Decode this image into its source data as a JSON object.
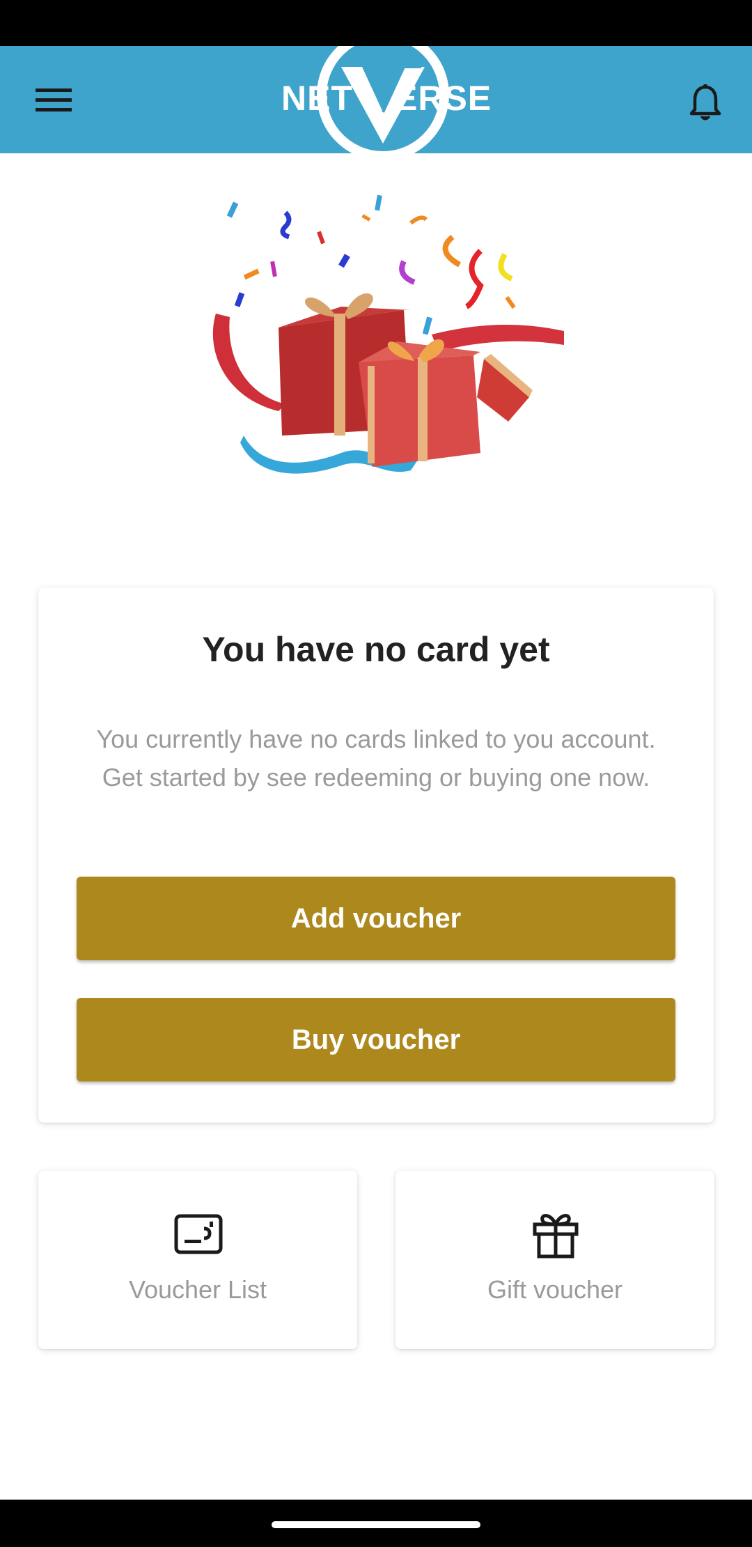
{
  "app": {
    "logo_left": "NET",
    "logo_right": "ERSE",
    "menu_icon": "hamburger-menu-icon",
    "notification_icon": "bell-icon",
    "bar_color": "#3fa4cb"
  },
  "empty_state": {
    "title": "You have no card yet",
    "description": "You currently have no cards linked to you account. Get started by see redeeming or buying one now.",
    "add_label": "Add voucher",
    "buy_label": "Buy voucher",
    "button_color": "#ad891d"
  },
  "tiles": [
    {
      "label": "Voucher List",
      "icon": "voucher-list-icon"
    },
    {
      "label": "Gift voucher",
      "icon": "gift-icon"
    }
  ]
}
